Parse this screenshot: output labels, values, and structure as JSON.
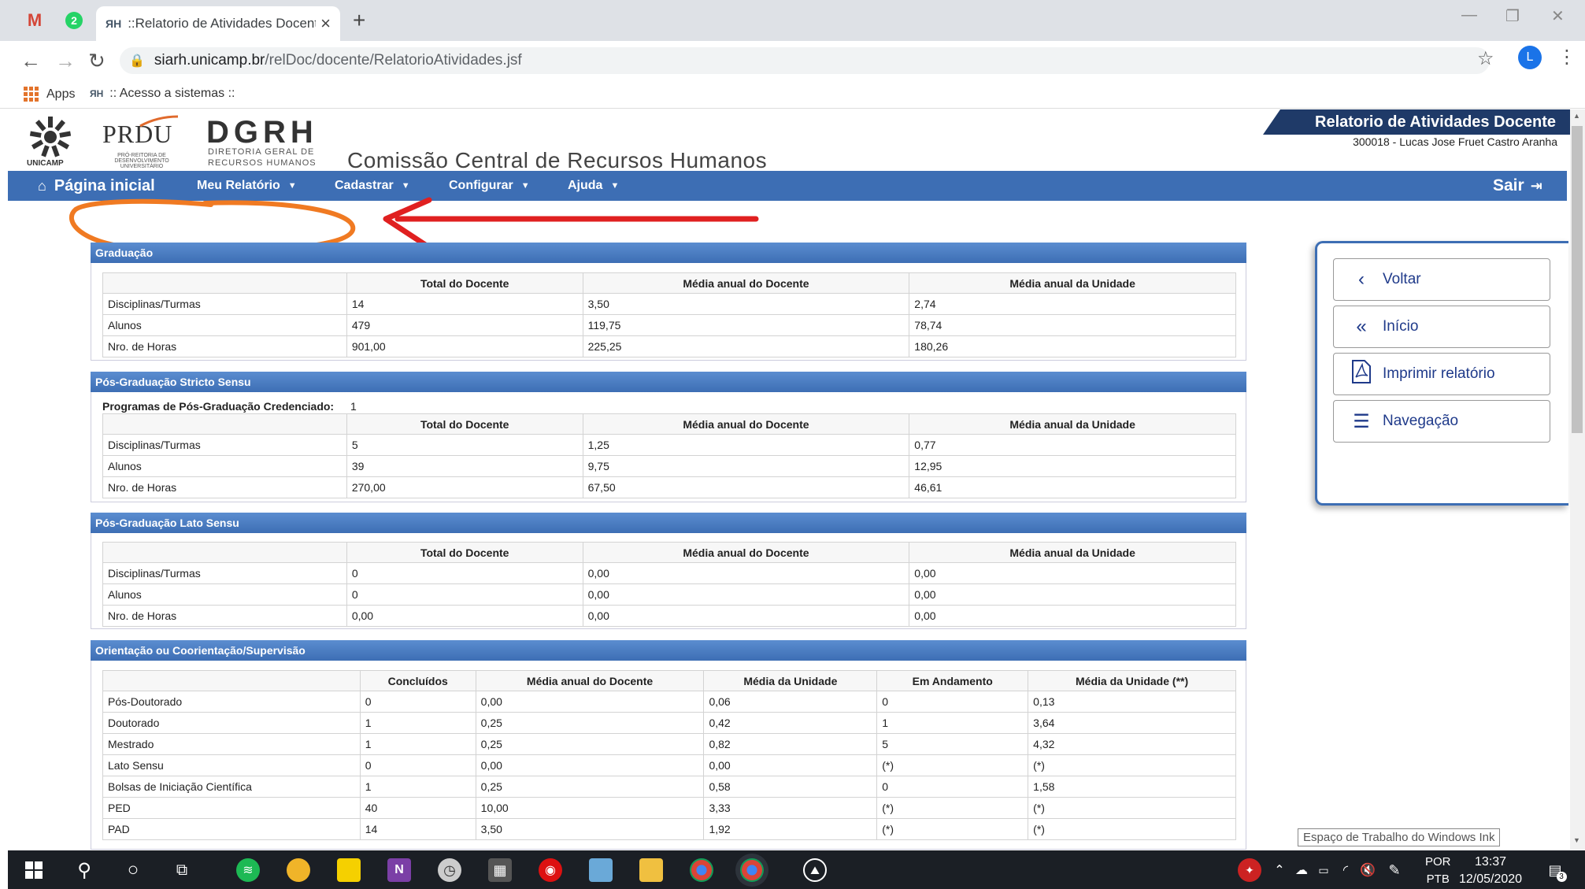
{
  "browser": {
    "tab_title": "::Relatorio de Atividades Docente",
    "tab_favicon": "ЯH",
    "pinned_tabs": [
      "M",
      "2"
    ],
    "url_host": "siarh.unicamp.br",
    "url_path": "/relDoc/docente/RelatorioAtividades.jsf",
    "profile_initial": "L",
    "bookmarks": [
      {
        "label": "Apps"
      },
      {
        "icon": "ЯH",
        "label": ":: Acesso a sistemas ::"
      }
    ]
  },
  "header": {
    "unicamp": "UNICAMP",
    "prdu": "PRDU",
    "prdu_sub": "PRÓ-REITORIA DE DESENVOLVIMENTO UNIVERSITÁRIO",
    "dgrh": "DGRH",
    "dgrh_sub1": "DIRETORIA GERAL DE",
    "dgrh_sub2": "RECURSOS HUMANOS",
    "page_heading": "Comissão Central de Recursos Humanos",
    "report_title": "Relatorio de Atividades Docente",
    "report_user": "300018 - Lucas Jose Fruet Castro Aranha"
  },
  "menu": {
    "home": "Página inicial",
    "items": [
      "Meu Relatório",
      "Cadastrar",
      "Configurar",
      "Ajuda"
    ],
    "logout": "Sair"
  },
  "sections": {
    "graduacao": {
      "title": "Graduação",
      "headers": [
        "",
        "Total do Docente",
        "Média anual do Docente",
        "Média anual da Unidade"
      ],
      "rows": [
        [
          "Disciplinas/Turmas",
          "14",
          "3,50",
          "2,74"
        ],
        [
          "Alunos",
          "479",
          "119,75",
          "78,74"
        ],
        [
          "Nro. de Horas",
          "901,00",
          "225,25",
          "180,26"
        ]
      ]
    },
    "stricto": {
      "title": "Pós-Graduação Stricto Sensu",
      "prog_label": "Programas de Pós-Graduação Credenciado:",
      "prog_value": "1",
      "headers": [
        "",
        "Total do Docente",
        "Média anual do Docente",
        "Média anual da Unidade"
      ],
      "rows": [
        [
          "Disciplinas/Turmas",
          "5",
          "1,25",
          "0,77"
        ],
        [
          "Alunos",
          "39",
          "9,75",
          "12,95"
        ],
        [
          "Nro. de Horas",
          "270,00",
          "67,50",
          "46,61"
        ]
      ]
    },
    "lato": {
      "title": "Pós-Graduação Lato Sensu",
      "headers": [
        "",
        "Total do Docente",
        "Média anual do Docente",
        "Média anual da Unidade"
      ],
      "rows": [
        [
          "Disciplinas/Turmas",
          "0",
          "0,00",
          "0,00"
        ],
        [
          "Alunos",
          "0",
          "0,00",
          "0,00"
        ],
        [
          "Nro. de Horas",
          "0,00",
          "0,00",
          "0,00"
        ]
      ]
    },
    "orientacao": {
      "title": "Orientação ou Coorientação/Supervisão",
      "headers": [
        "",
        "Concluídos",
        "Média anual do Docente",
        "Média da Unidade",
        "Em Andamento",
        "Média da Unidade (**)"
      ],
      "rows": [
        [
          "Pós-Doutorado",
          "0",
          "0,00",
          "0,06",
          "0",
          "0,13"
        ],
        [
          "Doutorado",
          "1",
          "0,25",
          "0,42",
          "1",
          "3,64"
        ],
        [
          "Mestrado",
          "1",
          "0,25",
          "0,82",
          "5",
          "4,32"
        ],
        [
          "Lato Sensu",
          "0",
          "0,00",
          "0,00",
          "(*)",
          "(*)"
        ],
        [
          "Bolsas de Iniciação Científica",
          "1",
          "0,25",
          "0,58",
          "0",
          "1,58"
        ],
        [
          "PED",
          "40",
          "10,00",
          "3,33",
          "(*)",
          "(*)"
        ],
        [
          "PAD",
          "14",
          "3,50",
          "1,92",
          "(*)",
          "(*)"
        ]
      ]
    }
  },
  "sidepanel": {
    "voltar": "Voltar",
    "inicio": "Início",
    "imprimir": "Imprimir relatório",
    "navegacao": "Navegação"
  },
  "tooltip": "Espaço de Trabalho do Windows Ink",
  "taskbar": {
    "lang1": "POR",
    "lang2": "PTB",
    "time": "13:37",
    "date": "12/05/2020",
    "notif_count": "3"
  },
  "colors": {
    "menu_blue": "#3d6eb4",
    "title_navy": "#1f3a68",
    "annotation_orange": "#f07a22",
    "annotation_red": "#e02020"
  }
}
